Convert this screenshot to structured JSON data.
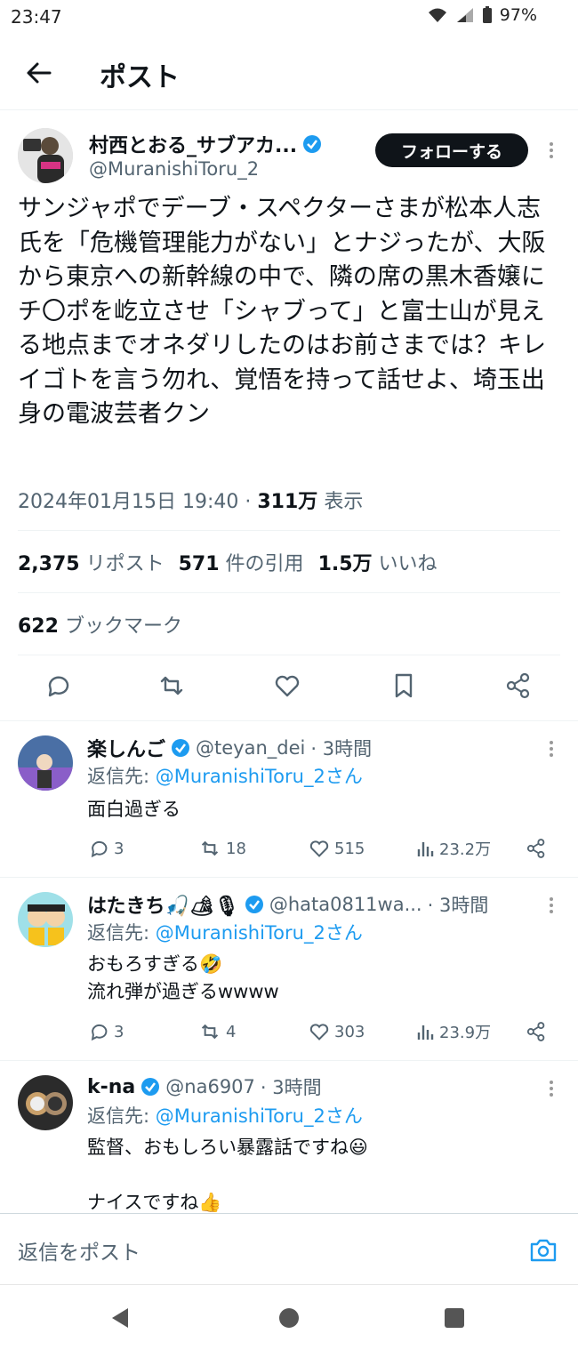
{
  "status": {
    "time": "23:47",
    "battery": "97%"
  },
  "header": {
    "title": "ポスト"
  },
  "tweet": {
    "name": "村西とおる_サブアカ...",
    "handle": "@MuranishiToru_2",
    "follow_label": "フォローする",
    "text": "サンジャポでデーブ・スペクターさまが松本人志氏を「危機管理能力がない」とナジったが、大阪から東京への新幹線の中で、隣の席の黒木香嬢にチ〇ポを屹立させ「シャブって」と富士山が見える地点までオネダリしたのはお前さまでは？キレイゴトを言う勿れ、覚悟を持って話せよ、埼玉出身の電波芸者クン",
    "datetime": "2024年01月15日 19:40",
    "views": "311万",
    "views_label": "表示",
    "reposts": "2,375",
    "reposts_label": "リポスト",
    "quotes": "571",
    "quotes_label": "件の引用",
    "likes": "1.5万",
    "likes_label": "いいね",
    "bookmarks": "622",
    "bookmarks_label": "ブックマーク"
  },
  "replies": [
    {
      "name": "楽しんご",
      "handle": "@teyan_dei",
      "time": "· 3時間",
      "reply_to_prefix": "返信先:",
      "reply_to": "@MuranishiToru_2さん",
      "lines": [
        "面白過ぎる"
      ],
      "replies": "3",
      "reposts": "18",
      "likes": "515",
      "views": "23.2万"
    },
    {
      "name": "はたきち🎣🏕🎙",
      "handle": "@hata0811wa...",
      "time": "· 3時間",
      "reply_to_prefix": "返信先:",
      "reply_to": "@MuranishiToru_2さん",
      "lines": [
        "おもろすぎる🤣",
        "流れ弾が過ぎるwwww"
      ],
      "replies": "3",
      "reposts": "4",
      "likes": "303",
      "views": "23.9万"
    },
    {
      "name": "k-na",
      "handle": "@na6907",
      "time": "· 3時間",
      "reply_to_prefix": "返信先:",
      "reply_to": "@MuranishiToru_2さん",
      "lines": [
        "監督、おもしろい暴露話ですね😃",
        "",
        "ナイスですね👍"
      ]
    }
  ],
  "reply_bar": {
    "placeholder": "返信をポスト"
  },
  "colors": {
    "accent": "#1d9bf0",
    "text": "#0f1419",
    "muted": "#536471"
  }
}
